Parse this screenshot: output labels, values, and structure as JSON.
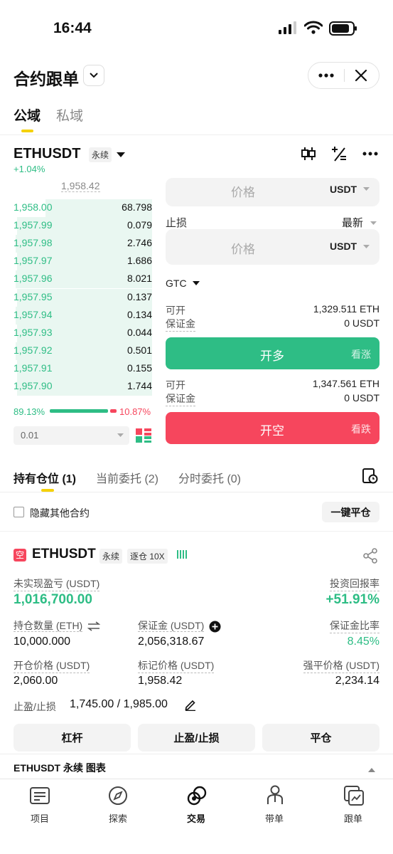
{
  "status_bar": {
    "time": "16:44"
  },
  "header": {
    "title": "合约跟单"
  },
  "domain_tabs": [
    {
      "label": "公域"
    },
    {
      "label": "私域"
    }
  ],
  "symbol": {
    "name": "ETHUSDT",
    "type": "永续",
    "change": "+1.04%"
  },
  "orderbook": {
    "mid_price": "1,958.42",
    "bids": [
      {
        "price": "1,958.00",
        "qty": "68.798"
      },
      {
        "price": "1,957.99",
        "qty": "0.079"
      },
      {
        "price": "1,957.98",
        "qty": "2.746"
      },
      {
        "price": "1,957.97",
        "qty": "1.686"
      },
      {
        "price": "1,957.96",
        "qty": "8.021"
      },
      {
        "price": "1,957.95",
        "qty": "0.137"
      },
      {
        "price": "1,957.94",
        "qty": "0.134"
      },
      {
        "price": "1,957.93",
        "qty": "0.044"
      },
      {
        "price": "1,957.92",
        "qty": "0.501"
      },
      {
        "price": "1,957.91",
        "qty": "0.155"
      },
      {
        "price": "1,957.90",
        "qty": "1.744"
      }
    ],
    "buy_ratio": "89.13%",
    "sell_ratio": "10.87%",
    "buy_fraction": 0.8913,
    "precision": "0.01"
  },
  "order_form": {
    "price_placeholder": "价格",
    "unit": "USDT",
    "stop_loss_label": "止损",
    "stop_loss_trigger": "最新",
    "tif": "GTC",
    "long": {
      "avail_label": "可开",
      "avail_value": "1,329.511 ETH",
      "margin_label": "保证金",
      "margin_value": "0 USDT",
      "button": "开多",
      "hint": "看涨"
    },
    "short": {
      "avail_label": "可开",
      "avail_value": "1,347.561 ETH",
      "margin_label": "保证金",
      "margin_value": "0 USDT",
      "button": "开空",
      "hint": "看跌"
    }
  },
  "position_tabs": [
    {
      "label": "持有仓位 (1)"
    },
    {
      "label": "当前委托 (2)"
    },
    {
      "label": "分时委托 (0)"
    }
  ],
  "hide_other": {
    "label": "隐藏其他合约"
  },
  "close_all": {
    "label": "一键平仓"
  },
  "position": {
    "side_badge": "空",
    "symbol": "ETHUSDT",
    "type": "永续",
    "margin_mode": "逐仓 10X",
    "unrealized_label": "未实现盈亏 (USDT)",
    "unrealized_value": "1,016,700.00",
    "roi_label": "投资回报率",
    "roi_value": "+51.91%",
    "size_label": "持仓数量 (ETH)",
    "size_value": "10,000.000",
    "margin_label": "保证金 (USDT)",
    "margin_value": "2,056,318.67",
    "margin_ratio_label": "保证金比率",
    "margin_ratio_value": "8.45%",
    "entry_label": "开仓价格 (USDT)",
    "entry_value": "2,060.00",
    "mark_label": "标记价格 (USDT)",
    "mark_value": "1,958.42",
    "liq_label": "强平价格 (USDT)",
    "liq_value": "2,234.14",
    "tpsl_label": "止盈/止损",
    "tpsl_value": "1,745.00 / 1,985.00",
    "buttons": [
      {
        "label": "杠杆"
      },
      {
        "label": "止盈/止损"
      },
      {
        "label": "平仓"
      }
    ]
  },
  "chart_bar": {
    "label": "ETHUSDT 永续 图表"
  },
  "tabbar": [
    {
      "label": "项目"
    },
    {
      "label": "探索"
    },
    {
      "label": "交易"
    },
    {
      "label": "带单"
    },
    {
      "label": "跟单"
    }
  ]
}
